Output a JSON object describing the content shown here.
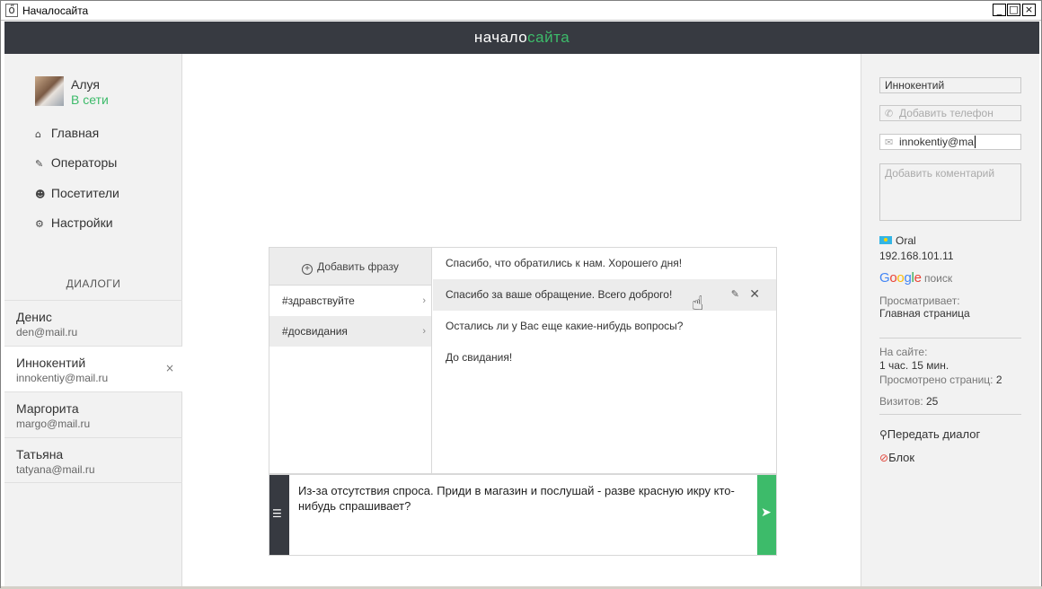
{
  "window": {
    "title": "Началосайта",
    "minimize": "_",
    "maximize": "□",
    "close": "×"
  },
  "header": {
    "logo_part1": "начало",
    "logo_part2": "сайта"
  },
  "user": {
    "name": "Алуя",
    "status": "В сети"
  },
  "nav": [
    {
      "icon": "home-icon",
      "glyph": "🏠",
      "label": "Главная"
    },
    {
      "icon": "operators-icon",
      "glyph": "✎",
      "label": "Операторы"
    },
    {
      "icon": "visitors-icon",
      "glyph": "👥",
      "label": "Посетители"
    },
    {
      "icon": "gear-icon",
      "glyph": "⚙",
      "label": "Настройки"
    }
  ],
  "dialogs": {
    "title": "ДИАЛОГИ",
    "items": [
      {
        "name": "Денис",
        "email": "den@mail.ru"
      },
      {
        "name": "Иннокентий",
        "email": "innokentiy@mail.ru",
        "close": "×"
      },
      {
        "name": "Маргорита",
        "email": "margo@mail.ru"
      },
      {
        "name": "Татьяна",
        "email": "tatyana@mail.ru"
      }
    ]
  },
  "phrases": {
    "add_label": "Добавить фразу",
    "categories": [
      "#здравствуйте",
      "#досвидания"
    ],
    "list": [
      "Спасибо, что обратились к нам. Хорошего дня!",
      "Спасибо за ваше обращение. Всего доброго!",
      "Остались ли у Вас еще какие-нибудь вопросы?",
      "До свидания!"
    ]
  },
  "compose": {
    "text": "Из-за отсутствия спроса. Приди в магазин и послушай - разве красную икру кто-нибудь спрашивает?"
  },
  "visitor": {
    "name": "Иннокентий",
    "phone_placeholder": "Добавить телефон",
    "email": "innokentiy@ma",
    "comment_placeholder": "Добавить коментарий",
    "city": "Oral",
    "ip": "192.168.101.11",
    "search_engine": "Google",
    "search_label": "поиск",
    "viewing_label": "Просматривает:",
    "viewing_page": "Главная страница",
    "on_site_label": "На сайте:",
    "on_site_time": "1 час. 15 мин.",
    "pages_viewed_label": "Просмотрено страниц:",
    "pages_viewed": "2",
    "visits_label": "Визитов:",
    "visits": "25",
    "transfer_label": "Передать диалог",
    "block_label": "Блок"
  },
  "colors": {
    "accent_green": "#3dbb6a",
    "header_dark": "#373a41"
  }
}
